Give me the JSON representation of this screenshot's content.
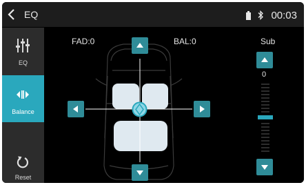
{
  "header": {
    "title": "EQ",
    "time": "00:03"
  },
  "sidebar": {
    "items": [
      {
        "label": "EQ",
        "active": false
      },
      {
        "label": "Balance",
        "active": true
      },
      {
        "label": "Reset",
        "active": false
      }
    ]
  },
  "balance": {
    "fad_label": "FAD:0",
    "bal_label": "BAL:0"
  },
  "sub": {
    "label": "Sub",
    "value": "0",
    "level_fraction": 0.5
  },
  "colors": {
    "accent": "#2aa8bd",
    "button": "#2f8c98",
    "seat": "#dfe9f0"
  }
}
